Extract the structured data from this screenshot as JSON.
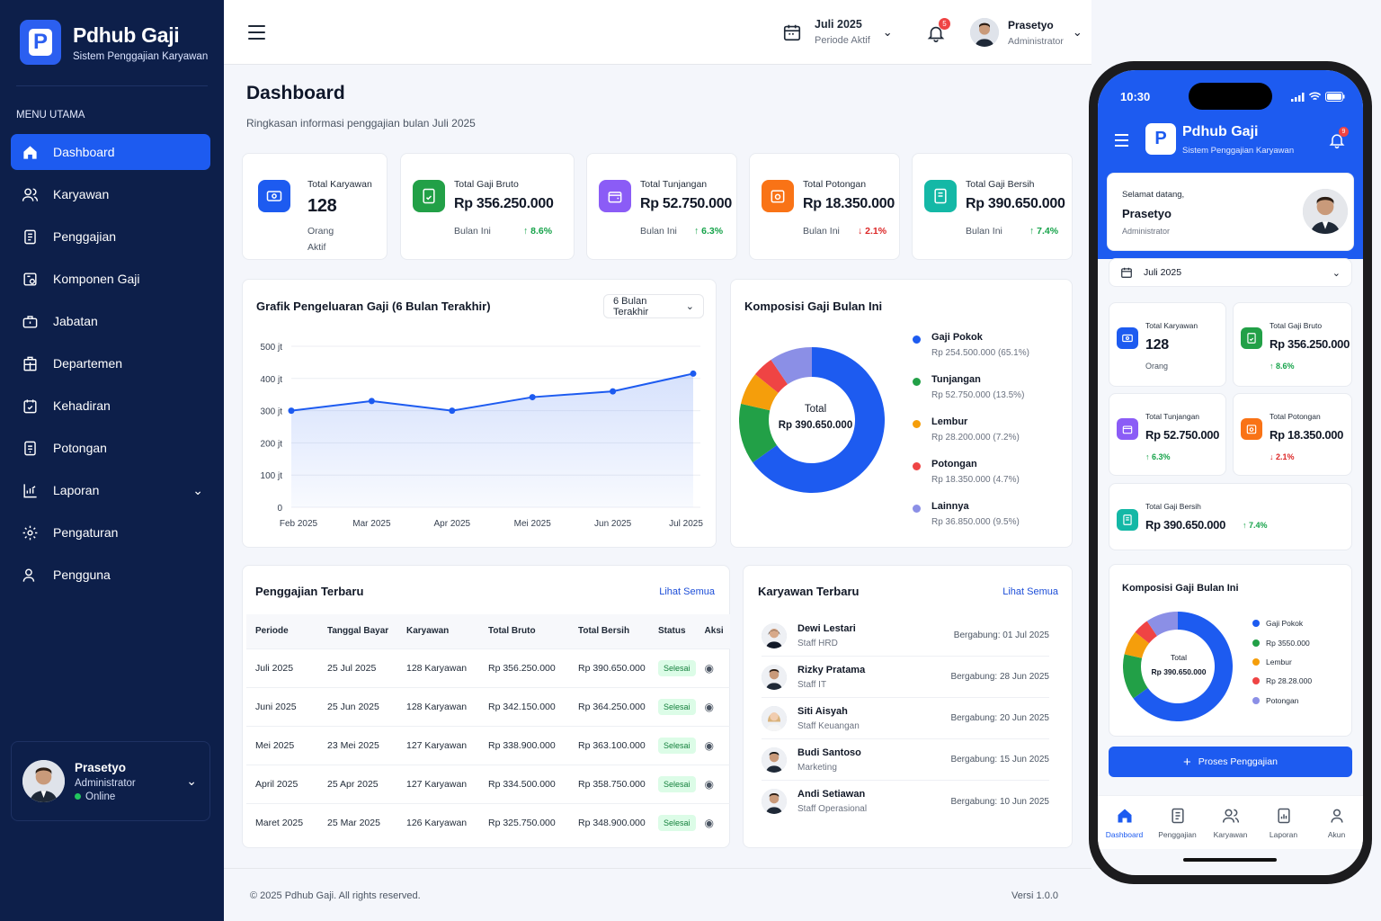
{
  "app": {
    "name": "Pdhub Gaji",
    "subtitle": "Sistem Penggajian Karyawan"
  },
  "sidebar": {
    "menu_title": "MENU UTAMA",
    "items": [
      {
        "label": "Dashboard",
        "icon": "home-icon",
        "active": true
      },
      {
        "label": "Karyawan",
        "icon": "users-icon"
      },
      {
        "label": "Penggajian",
        "icon": "document-icon"
      },
      {
        "label": "Komponen Gaji",
        "icon": "component-icon"
      },
      {
        "label": "Jabatan",
        "icon": "briefcase-icon"
      },
      {
        "label": "Departemen",
        "icon": "building-icon"
      },
      {
        "label": "Kehadiran",
        "icon": "calendar-check-icon"
      },
      {
        "label": "Potongan",
        "icon": "receipt-icon"
      },
      {
        "label": "Laporan",
        "icon": "report-icon"
      },
      {
        "label": "Pengaturan",
        "icon": "gear-icon"
      },
      {
        "label": "Pengguna",
        "icon": "user-icon"
      }
    ],
    "user": {
      "name": "Prasetyo",
      "role": "Administrator",
      "status": "Online"
    }
  },
  "topbar": {
    "period_label": "Juli 2025",
    "period_sub": "Periode Aktif",
    "notif_count": "5",
    "user_name": "Prasetyo",
    "user_role": "Administrator"
  },
  "page": {
    "title": "Dashboard",
    "subtitle": "Ringkasan informasi penggajian bulan Juli 2025"
  },
  "stats": {
    "karyawan": {
      "label": "Total Karyawan",
      "value": "128",
      "sub1": "Orang",
      "sub2": "Aktif"
    },
    "bruto": {
      "label": "Total Gaji Bruto",
      "value": "Rp 356.250.000",
      "sub": "Bulan Ini",
      "trend": "8.6%"
    },
    "tunjangan": {
      "label": "Total Tunjangan",
      "value": "Rp 52.750.000",
      "sub": "Bulan Ini",
      "trend": "6.3%"
    },
    "potongan": {
      "label": "Total Potongan",
      "value": "Rp 18.350.000",
      "sub": "Bulan Ini",
      "trend": "2.1%"
    },
    "bersih": {
      "label": "Total Gaji Bersih",
      "value": "Rp 390.650.000",
      "sub": "Bulan Ini",
      "trend": "7.4%"
    }
  },
  "line_card": {
    "title": "Grafik Pengeluaran Gaji (6 Bulan Terakhir)",
    "filter": "6 Bulan Terakhir"
  },
  "chart_data": {
    "type": "area",
    "categories": [
      "Feb 2025",
      "Mar 2025",
      "Apr 2025",
      "Mei 2025",
      "Jun 2025",
      "Jul 2025"
    ],
    "values": [
      300,
      330,
      300,
      342,
      360,
      415
    ],
    "ylim": [
      0,
      500
    ],
    "yticks": [
      0,
      100,
      200,
      300,
      400,
      500
    ],
    "ytick_labels": [
      "0",
      "100 jt",
      "200 jt",
      "300 jt",
      "400 jt",
      "500 jt"
    ],
    "color": "#1d5bf0",
    "grid": true
  },
  "donut_card": {
    "title": "Komposisi Gaji Bulan Ini",
    "center_label": "Total",
    "center_value": "Rp 390.650.000",
    "slices": [
      {
        "name": "Gaji Pokok",
        "detail": "Rp 254.500.000 (65.1%)",
        "pct": 65.1,
        "color": "#1d5bf0"
      },
      {
        "name": "Tunjangan",
        "detail": "Rp 52.750.000 (13.5%)",
        "pct": 13.5,
        "color": "#22a047"
      },
      {
        "name": "Lembur",
        "detail": "Rp 28.200.000 (7.2%)",
        "pct": 7.2,
        "color": "#f59e0b"
      },
      {
        "name": "Potongan",
        "detail": "Rp 18.350.000 (4.7%)",
        "pct": 4.7,
        "color": "#ef4444"
      },
      {
        "name": "Lainnya",
        "detail": "Rp 36.850.000 (9.5%)",
        "pct": 9.5,
        "color": "#8b8fe6"
      }
    ]
  },
  "payroll": {
    "title": "Penggajian Terbaru",
    "link": "Lihat Semua",
    "columns": [
      "Periode",
      "Tanggal Bayar",
      "Karyawan",
      "Total Bruto",
      "Total Bersih",
      "Status",
      "Aksi"
    ],
    "rows": [
      [
        "Juli 2025",
        "25 Jul 2025",
        "128 Karyawan",
        "Rp 356.250.000",
        "Rp 390.650.000",
        "Selesai"
      ],
      [
        "Juni 2025",
        "25 Jun 2025",
        "128 Karyawan",
        "Rp 342.150.000",
        "Rp 364.250.000",
        "Selesai"
      ],
      [
        "Mei 2025",
        "23 Mei 2025",
        "127 Karyawan",
        "Rp 338.900.000",
        "Rp 363.100.000",
        "Selesai"
      ],
      [
        "April 2025",
        "25 Apr 2025",
        "127 Karyawan",
        "Rp 334.500.000",
        "Rp 358.750.000",
        "Selesai"
      ],
      [
        "Maret 2025",
        "25 Mar 2025",
        "126 Karyawan",
        "Rp 325.750.000",
        "Rp 348.900.000",
        "Selesai"
      ]
    ]
  },
  "employees": {
    "title": "Karyawan Terbaru",
    "link": "Lihat Semua",
    "items": [
      {
        "name": "Dewi Lestari",
        "role": "Staff HRD",
        "joined": "Bergabung: 01 Jul 2025"
      },
      {
        "name": "Rizky Pratama",
        "role": "Staff IT",
        "joined": "Bergabung: 28 Jun 2025"
      },
      {
        "name": "Siti Aisyah",
        "role": "Staff Keuangan",
        "joined": "Bergabung: 20 Jun 2025"
      },
      {
        "name": "Budi Santoso",
        "role": "Marketing",
        "joined": "Bergabung: 15 Jun 2025"
      },
      {
        "name": "Andi Setiawan",
        "role": "Staff Operasional",
        "joined": "Bergabung: 10 Jun 2025"
      }
    ]
  },
  "footer": {
    "copyright": "© 2025 Pdhub Gaji. All rights reserved.",
    "version": "Versi 1.0.0"
  },
  "mobile": {
    "time": "10:30",
    "app_name": "Pdhub Gaji",
    "app_sub": "Sistem Penggajian Karyawan",
    "notif_count": "9",
    "welcome": "Selamat datang,",
    "user_name": "Prasetyo",
    "user_role": "Administrator",
    "period": "Juli 2025",
    "stats": {
      "karyawan": {
        "label": "Total Karyawan",
        "value": "128",
        "sub": "Orang"
      },
      "bruto": {
        "label": "Total Gaji Bruto",
        "value": "Rp 356.250.000",
        "trend": "8.6%"
      },
      "tunjangan": {
        "label": "Total Tunjangan",
        "value": "Rp 52.750.000",
        "trend": "6.3%"
      },
      "potongan": {
        "label": "Total Potongan",
        "value": "Rp 18.350.000",
        "trend": "2.1%"
      },
      "bersih": {
        "label": "Total Gaji Bersih",
        "value": "Rp 390.650.000",
        "trend": "7.4%"
      }
    },
    "donut": {
      "title": "Komposisi Gaji Bulan Ini",
      "center_label": "Total",
      "center_value": "Rp 390.650.000",
      "legend": [
        "Gaji Pokok",
        "Rp 3550.000",
        "Lembur",
        "Rp 28.28.000",
        "Potongan"
      ]
    },
    "cta": "Proses Penggajian",
    "tabs": [
      "Dashboard",
      "Penggajian",
      "Karyawan",
      "Laporan",
      "Akun"
    ]
  }
}
